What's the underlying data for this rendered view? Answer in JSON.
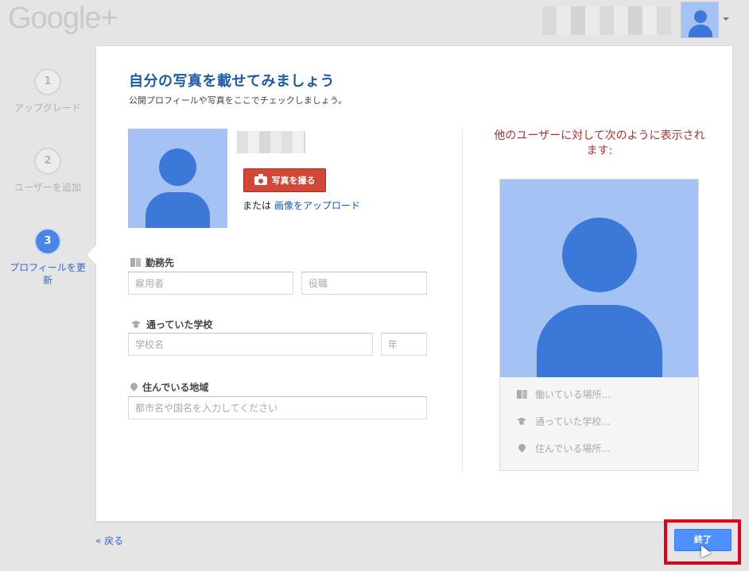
{
  "header": {
    "logo": "Google+"
  },
  "steps": [
    {
      "number": "1",
      "label": "アップグレード"
    },
    {
      "number": "2",
      "label": "ユーザーを追加"
    },
    {
      "number": "3",
      "label": "プロフィールを更新"
    }
  ],
  "main": {
    "title": "自分の写真を載せてみましょう",
    "subtitle": "公開プロフィールや写真をここでチェックしましょう。",
    "take_photo_label": "写真を撮る",
    "or_text": "または",
    "upload_link": "画像をアップロード",
    "work_section": {
      "label": "勤務先",
      "employer_placeholder": "雇用者",
      "title_placeholder": "役職"
    },
    "school_section": {
      "label": "通っていた学校",
      "school_placeholder": "学校名",
      "year_placeholder": "年"
    },
    "location_section": {
      "label": "住んでいる地域",
      "location_placeholder": "都市名や国名を入力してください"
    }
  },
  "preview": {
    "title": "他のユーザーに対して次のように表示されます:",
    "rows": [
      {
        "icon": "building-icon",
        "text": "働いている場所..."
      },
      {
        "icon": "graduation-cap-icon",
        "text": "通っていた学校..."
      },
      {
        "icon": "location-pin-icon",
        "text": "住んでいる場所..."
      }
    ]
  },
  "footer": {
    "back_label": "« 戻る",
    "finish_label": "終了"
  },
  "colors": {
    "accent_blue": "#4d90fe",
    "photo_bg": "#a4c2f4",
    "avatar_blue": "#3c78d8",
    "photo_button_red": "#d14836",
    "highlight_red": "#e0001b"
  }
}
